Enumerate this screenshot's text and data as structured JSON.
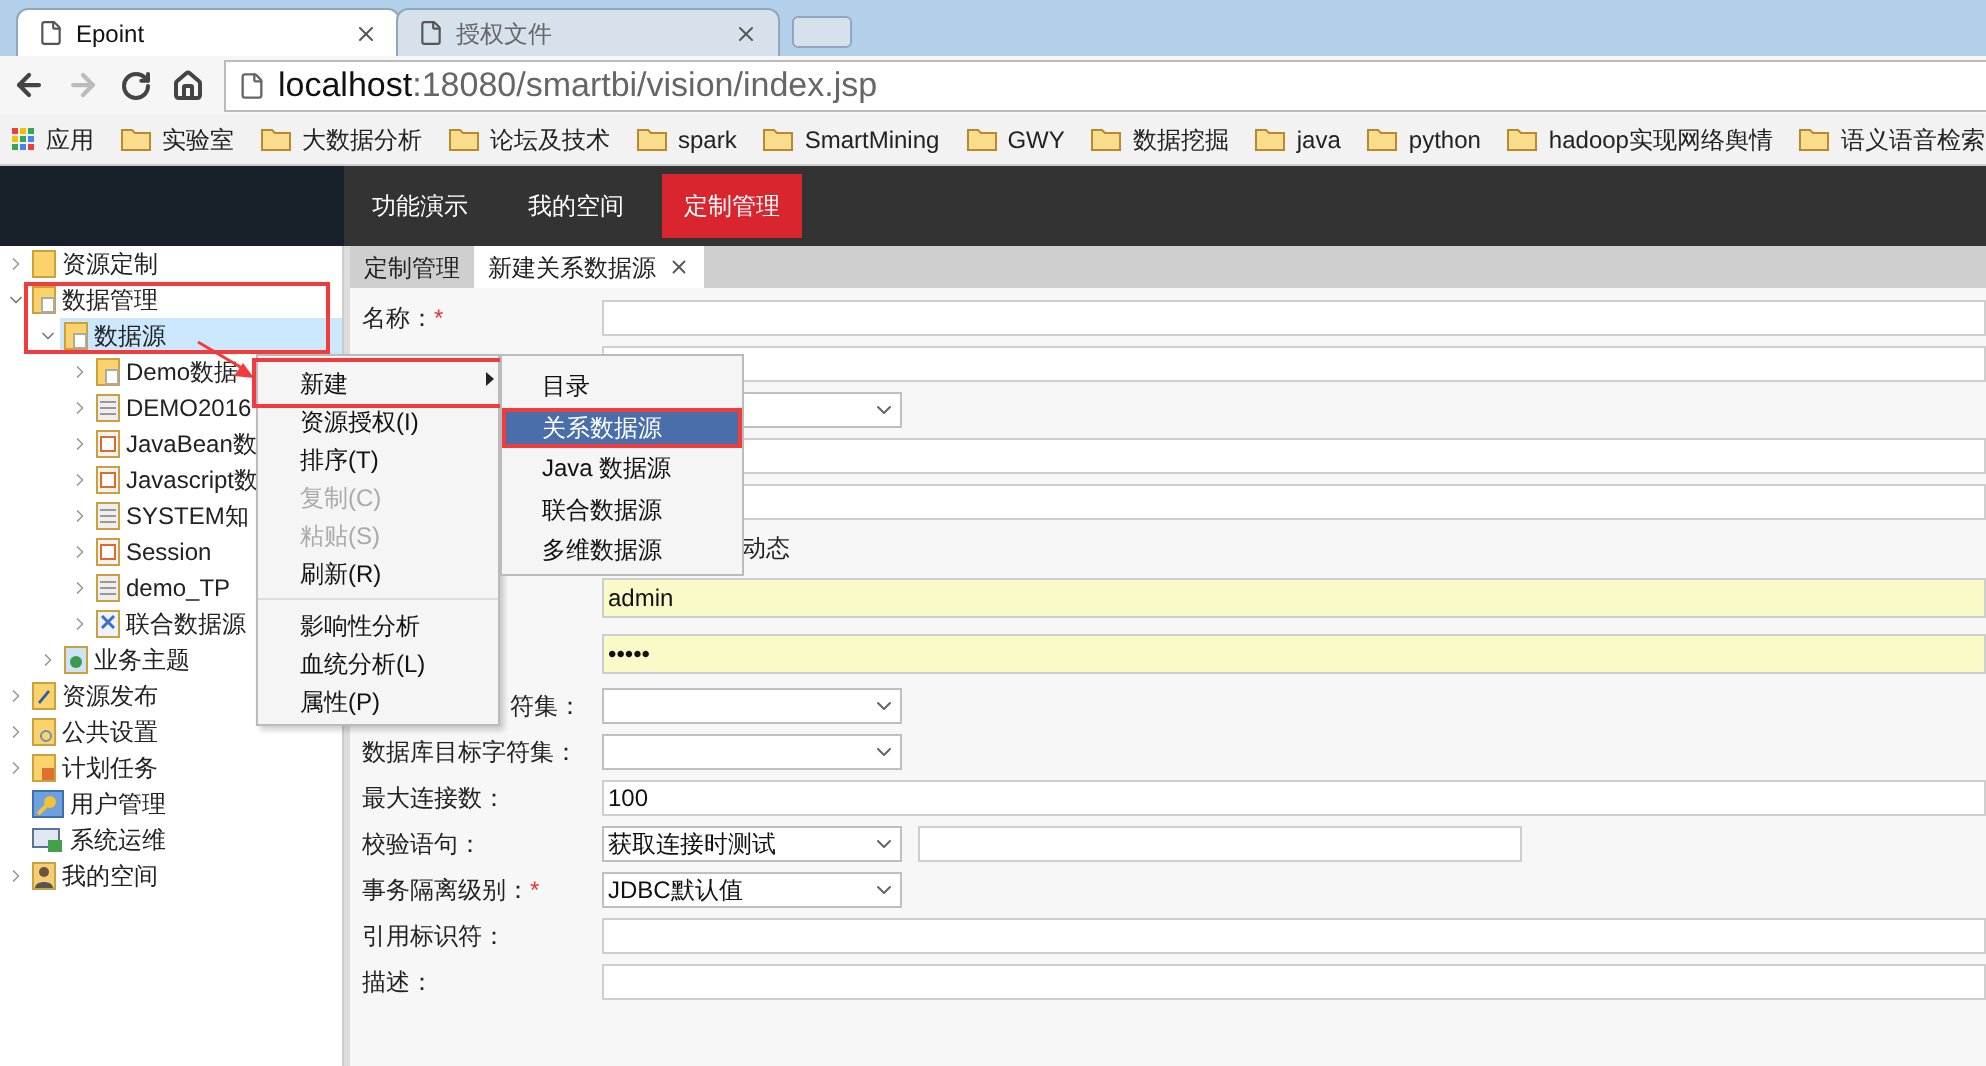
{
  "browser": {
    "tabs": [
      {
        "title": "Epoint",
        "selected": true
      },
      {
        "title": "授权文件",
        "selected": false
      }
    ],
    "address": {
      "host": "localhost",
      "path": ":18080/smartbi/vision/index.jsp"
    },
    "bookmarks": [
      {
        "label": "应用",
        "kind": "apps"
      },
      {
        "label": "实验室",
        "kind": "folder"
      },
      {
        "label": "大数据分析",
        "kind": "folder"
      },
      {
        "label": "论坛及技术",
        "kind": "folder"
      },
      {
        "label": "spark",
        "kind": "folder"
      },
      {
        "label": "SmartMining",
        "kind": "folder"
      },
      {
        "label": "GWY",
        "kind": "folder"
      },
      {
        "label": "数据挖掘",
        "kind": "folder"
      },
      {
        "label": "java",
        "kind": "folder"
      },
      {
        "label": "python",
        "kind": "folder"
      },
      {
        "label": "hadoop实现网络舆情",
        "kind": "folder"
      },
      {
        "label": "语义语音检索",
        "kind": "folder"
      }
    ]
  },
  "header": {
    "nav": [
      {
        "label": "功能演示",
        "selected": false
      },
      {
        "label": "我的空间",
        "selected": false
      },
      {
        "label": "定制管理",
        "selected": true
      }
    ]
  },
  "tree": [
    {
      "label": "资源定制",
      "kind": "folder",
      "expanded": false,
      "selected": false
    },
    {
      "label": "数据管理",
      "kind": "folder-doc",
      "expanded": true,
      "selected": false,
      "children": [
        {
          "label": "数据源",
          "kind": "folder-doc",
          "expanded": true,
          "selected": true,
          "children": [
            {
              "label": "Demo数据",
              "kind": "folder-doc",
              "expanded": false,
              "selected": false
            },
            {
              "label": "DEMO2016",
              "kind": "db",
              "expanded": false,
              "selected": false
            },
            {
              "label": "JavaBean数",
              "kind": "java",
              "expanded": false,
              "selected": false
            },
            {
              "label": "Javascript数",
              "kind": "java",
              "expanded": false,
              "selected": false
            },
            {
              "label": "SYSTEM知",
              "kind": "db",
              "expanded": false,
              "selected": false
            },
            {
              "label": "Session",
              "kind": "java",
              "expanded": false,
              "selected": false
            },
            {
              "label": "demo_TP",
              "kind": "db",
              "expanded": false,
              "selected": false
            },
            {
              "label": "联合数据源",
              "kind": "union",
              "expanded": false,
              "selected": false
            }
          ]
        },
        {
          "label": "业务主题",
          "kind": "topic",
          "expanded": false,
          "selected": false
        }
      ]
    },
    {
      "label": "资源发布",
      "kind": "publish",
      "expanded": false,
      "selected": false
    },
    {
      "label": "公共设置",
      "kind": "settings",
      "expanded": false,
      "selected": false
    },
    {
      "label": "计划任务",
      "kind": "task",
      "expanded": false,
      "selected": false
    },
    {
      "label": "用户管理",
      "kind": "user",
      "selected": false
    },
    {
      "label": "系统运维",
      "kind": "monitor",
      "selected": false
    },
    {
      "label": "我的空间",
      "kind": "person",
      "expanded": false,
      "selected": false
    }
  ],
  "content_tabs": [
    {
      "label": "定制管理",
      "selected": false,
      "closable": false
    },
    {
      "label": "新建关系数据源",
      "selected": true,
      "closable": true
    }
  ],
  "form": {
    "rows": [
      {
        "label": "名称：",
        "required_mark": "*",
        "kind": "input"
      },
      {
        "kind": "input"
      },
      {
        "kind": "select"
      },
      {
        "kind": "input"
      },
      {
        "kind": "input"
      },
      {
        "kind": "text",
        "text": "动态"
      },
      {
        "kind": "input",
        "value": "admin",
        "autofilled": true
      },
      {
        "kind": "input",
        "value": "•••••",
        "autofilled": true
      },
      {
        "label": "符集：",
        "label_cut": true,
        "kind": "select"
      },
      {
        "label": "数据库目标字符集：",
        "kind": "select"
      },
      {
        "label": "最大连接数：",
        "kind": "input",
        "value": "100"
      },
      {
        "label": "校验语句：",
        "kind": "select-input",
        "value": "获取连接时测试"
      },
      {
        "label": "事务隔离级别：",
        "required_mark": "*",
        "kind": "select",
        "value": "JDBC默认值"
      },
      {
        "label": "引用标识符：",
        "kind": "input"
      },
      {
        "label": "描述：",
        "kind": "input"
      }
    ]
  },
  "context_menu": {
    "items": [
      {
        "kind": "item",
        "label": "新建",
        "disabled": false,
        "submenu": true,
        "annotated": true
      },
      {
        "kind": "item",
        "label": "资源授权(I)",
        "disabled": false
      },
      {
        "kind": "item",
        "label": "排序(T)",
        "disabled": false
      },
      {
        "kind": "item",
        "label": "复制(C)",
        "disabled": true
      },
      {
        "kind": "item",
        "label": "粘贴(S)",
        "disabled": true
      },
      {
        "kind": "item",
        "label": "刷新(R)",
        "disabled": false
      },
      {
        "kind": "separator"
      },
      {
        "kind": "item",
        "label": "影响性分析",
        "disabled": false
      },
      {
        "kind": "item",
        "label": "血统分析(L)",
        "disabled": false
      },
      {
        "kind": "item",
        "label": "属性(P)",
        "disabled": false
      }
    ]
  },
  "submenu": {
    "items": [
      {
        "label": "目录",
        "selected": false
      },
      {
        "label": "关系数据源",
        "selected": true,
        "annotated": true
      },
      {
        "label": "Java 数据源",
        "selected": false
      },
      {
        "label": "联合数据源",
        "selected": false
      },
      {
        "label": "多维数据源",
        "selected": false
      }
    ]
  }
}
